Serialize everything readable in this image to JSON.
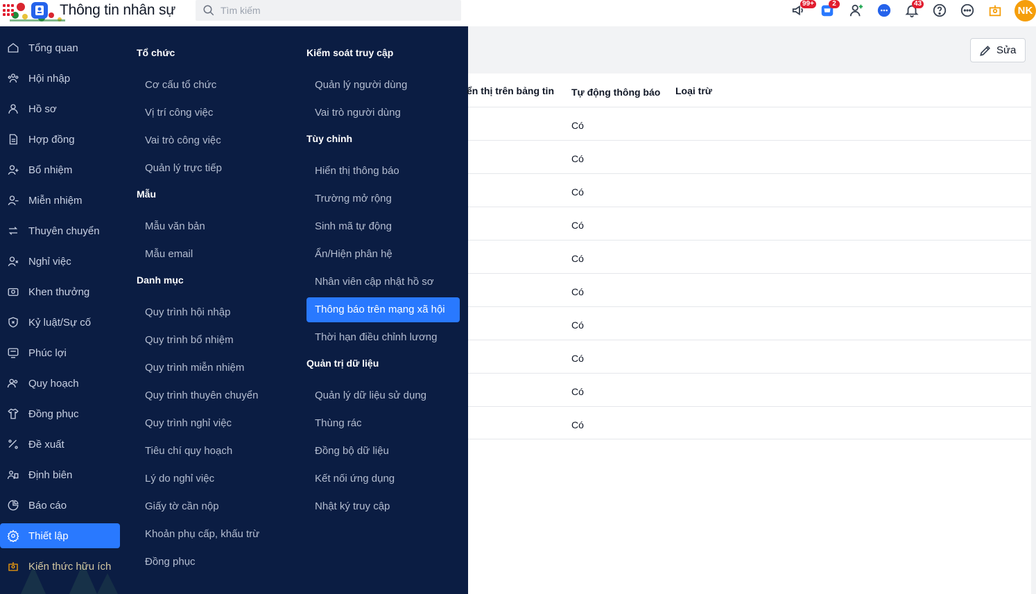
{
  "header": {
    "title": "Thông tin nhân sự",
    "search_placeholder": "Tìm kiếm",
    "badges": {
      "announcements": "99+",
      "cart": "2",
      "notifications": "43"
    },
    "avatar_initials": "NK",
    "brand_color": "#2979ff"
  },
  "sidebar": {
    "items": [
      {
        "label": "Tổng quan",
        "icon": "home-icon"
      },
      {
        "label": "Hội nhập",
        "icon": "users-join-icon"
      },
      {
        "label": "Hồ sơ",
        "icon": "user-icon"
      },
      {
        "label": "Hợp đồng",
        "icon": "document-icon"
      },
      {
        "label": "Bổ nhiệm",
        "icon": "user-plus-icon"
      },
      {
        "label": "Miễn nhiệm",
        "icon": "user-minus-icon"
      },
      {
        "label": "Thuyên chuyển",
        "icon": "transfer-icon"
      },
      {
        "label": "Nghỉ việc",
        "icon": "user-x-icon"
      },
      {
        "label": "Khen thưởng",
        "icon": "reward-icon"
      },
      {
        "label": "Kỷ luật/Sự cố",
        "icon": "shield-icon"
      },
      {
        "label": "Phúc lợi",
        "icon": "benefit-icon"
      },
      {
        "label": "Quy hoạch",
        "icon": "users-plan-icon"
      },
      {
        "label": "Đồng phục",
        "icon": "shirt-icon"
      },
      {
        "label": "Đề xuất",
        "icon": "proposal-icon"
      },
      {
        "label": "Định biên",
        "icon": "headcount-icon"
      },
      {
        "label": "Báo cáo",
        "icon": "pie-chart-icon"
      },
      {
        "label": "Thiết lập",
        "icon": "gear-icon",
        "active": true
      },
      {
        "label": "Kiến thức hữu ích",
        "icon": "knowledge-icon"
      }
    ]
  },
  "menu": {
    "col1": [
      {
        "heading": "Tổ chức",
        "items": [
          "Cơ cấu tổ chức",
          "Vị trí công việc",
          "Vai trò công việc",
          "Quản lý trực tiếp"
        ]
      },
      {
        "heading": "Mẫu",
        "items": [
          "Mẫu văn bản",
          "Mẫu email"
        ]
      },
      {
        "heading": "Danh mục",
        "items": [
          "Quy trình hội nhập",
          "Quy trình bổ nhiệm",
          "Quy trình miễn nhiệm",
          "Quy trình thuyên chuyển",
          "Quy trình nghỉ việc",
          "Tiêu chí quy hoạch",
          "Lý do nghỉ việc",
          "Giấy tờ cần nộp",
          "Khoản phụ cấp, khấu trừ",
          "Đồng phục"
        ]
      }
    ],
    "col2": [
      {
        "heading": "Kiểm soát truy cập",
        "items": [
          "Quản lý người dùng",
          "Vai trò người dùng"
        ]
      },
      {
        "heading": "Tùy chỉnh",
        "items": [
          "Hiển thị thông báo",
          "Trường mở rộng",
          "Sinh mã tự động",
          "Ẩn/Hiện phân hệ",
          "Nhân viên cập nhật hồ sơ",
          "Thông báo trên mạng xã hội",
          "Thời hạn điều chỉnh lương"
        ]
      },
      {
        "heading": "Quản trị dữ liệu",
        "items": [
          "Quản lý dữ liệu sử dụng",
          "Thùng rác",
          "Đồng bộ dữ liệu",
          "Kết nối ứng dụng",
          "Nhật ký truy cập"
        ]
      }
    ],
    "active_item": "Thông báo trên mạng xã hội"
  },
  "content": {
    "edit_label": "Sửa",
    "columns": [
      "ển thị trên bảng tin",
      "Tự động thông báo",
      "Loại trừ"
    ],
    "rows": [
      "Có",
      "Có",
      "Có",
      "Có",
      "Có",
      "Có",
      "Có",
      "Có",
      "Có",
      "Có"
    ]
  }
}
